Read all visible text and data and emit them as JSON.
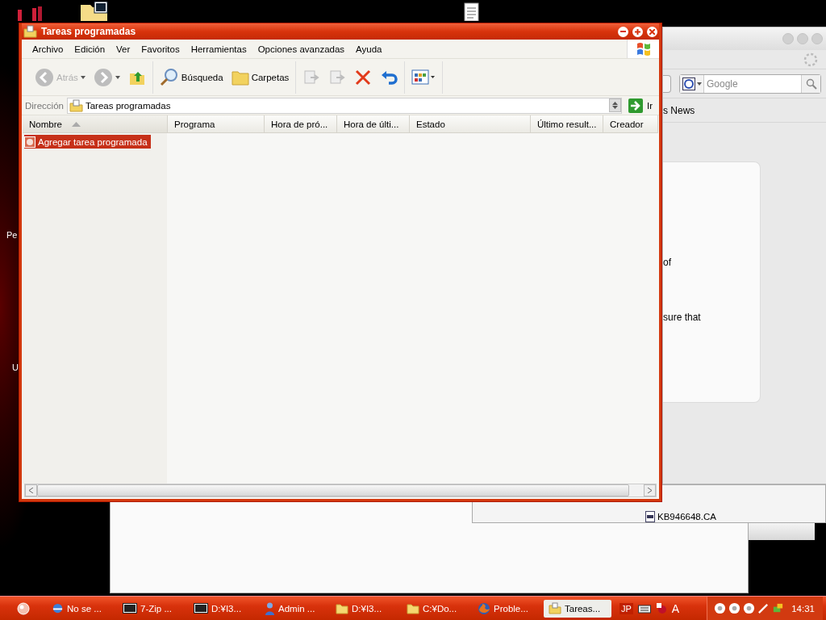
{
  "desktop": {
    "labels": [
      "Pe",
      "U"
    ]
  },
  "browser_window": {
    "search": {
      "placeholder": "Google"
    },
    "bookmark": "s News",
    "fragments": [
      "of",
      "sure that"
    ]
  },
  "file_window": {
    "file": "KB946648.CA"
  },
  "window": {
    "title": "Tareas programadas",
    "menu": [
      "Archivo",
      "Edición",
      "Ver",
      "Favoritos",
      "Herramientas",
      "Opciones avanzadas",
      "Ayuda"
    ],
    "toolbar_groups": [
      {
        "items": [
          {
            "kind": "back",
            "label": "Atrás",
            "disabled": true
          },
          {
            "kind": "forward",
            "disabled": true
          },
          {
            "kind": "up",
            "disabled": false
          }
        ]
      },
      {
        "items": [
          {
            "kind": "search",
            "label": "Búsqueda",
            "disabled": false
          },
          {
            "kind": "folders",
            "label": "Carpetas",
            "disabled": false
          }
        ]
      },
      {
        "items": [
          {
            "kind": "move",
            "disabled": true
          },
          {
            "kind": "copy",
            "disabled": true
          },
          {
            "kind": "delete",
            "disabled": false
          },
          {
            "kind": "undo",
            "disabled": false
          }
        ]
      },
      {
        "items": [
          {
            "kind": "views",
            "disabled": false
          }
        ]
      }
    ],
    "address": {
      "label": "Dirección",
      "value": "Tareas programadas",
      "go": "Ir"
    },
    "columns": [
      {
        "label": "Nombre",
        "sorted": true
      },
      {
        "label": "Programa",
        "sorted": false
      },
      {
        "label": "Hora de pró...",
        "sorted": false
      },
      {
        "label": "Hora de últi...",
        "sorted": false
      },
      {
        "label": "Estado",
        "sorted": false
      },
      {
        "label": "Último result...",
        "sorted": false
      },
      {
        "label": "Creador",
        "sorted": false
      }
    ],
    "rows": [
      {
        "name": "Agregar tarea programada",
        "selected": true
      }
    ]
  },
  "taskbar": {
    "items": [
      {
        "kind": "ie",
        "label": "No se ...",
        "selected": false
      },
      {
        "kind": "zip",
        "label": "7-Zip ...",
        "selected": false
      },
      {
        "kind": "zip",
        "label": "D:¥I3...",
        "selected": false
      },
      {
        "kind": "user",
        "label": "Admin ...",
        "selected": false
      },
      {
        "kind": "folder",
        "label": "D:¥I3...",
        "selected": false
      },
      {
        "kind": "folder",
        "label": "C:¥Do...",
        "selected": false
      },
      {
        "kind": "firefox",
        "label": "Proble...",
        "selected": false
      },
      {
        "kind": "tasks",
        "label": "Tareas...",
        "selected": true
      }
    ],
    "language": "JP",
    "ime": "A",
    "clock": "14:31"
  }
}
